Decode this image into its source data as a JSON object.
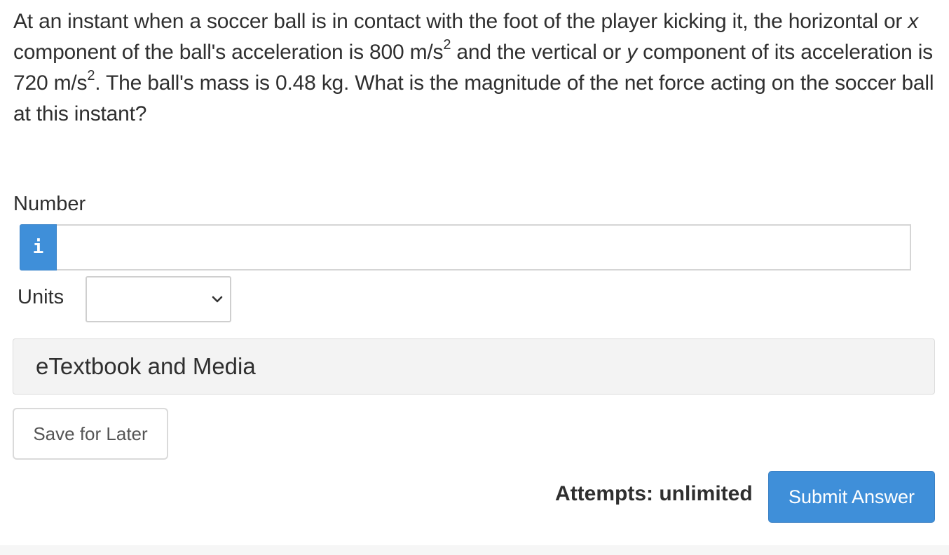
{
  "question": {
    "part1": "At an instant when a soccer ball is in contact with the foot of the player kicking it, the horizontal or ",
    "x_var": "x",
    "part2": " component of the ball's acceleration is 800 m/s",
    "sup1": "2",
    "part3": " and the vertical or ",
    "y_var": "y",
    "part4": " component of its acceleration is 720 m/s",
    "sup2": "2",
    "part5": ". The ball's mass is 0.48 kg. What is the magnitude of the net force acting on the soccer ball at this instant?"
  },
  "number_field": {
    "label": "Number",
    "info_icon_text": "i",
    "value": ""
  },
  "units_field": {
    "label": "Units",
    "selected": ""
  },
  "etextbook": {
    "label": "eTextbook and Media"
  },
  "save_button": {
    "label": "Save for Later"
  },
  "attempts": {
    "label": "Attempts: unlimited"
  },
  "submit_button": {
    "label": "Submit Answer"
  },
  "colors": {
    "accent": "#3f8fd9",
    "text": "#2f2f2f"
  }
}
